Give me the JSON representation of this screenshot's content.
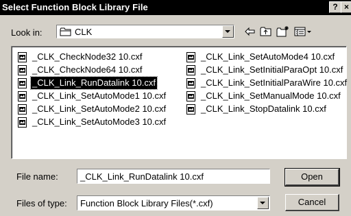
{
  "window": {
    "title": "Select Function Block Library File",
    "help_label": "?",
    "close_label": "×"
  },
  "lookin": {
    "label": "Look in:",
    "value": "CLK"
  },
  "files": [
    "_CLK_CheckNode32 10.cxf",
    "_CLK_CheckNode64 10.cxf",
    "_CLK_Link_RunDatalink 10.cxf",
    "_CLK_Link_SetAutoMode1 10.cxf",
    "_CLK_Link_SetAutoMode2 10.cxf",
    "_CLK_Link_SetAutoMode3 10.cxf",
    "_CLK_Link_SetAutoMode4 10.cxf",
    "_CLK_Link_SetInitialParaOpt 10.cxf",
    "_CLK_Link_SetInitialParaWire 10.cxf",
    "_CLK_Link_SetManualMode 10.cxf",
    "_CLK_Link_StopDatalink 10.cxf"
  ],
  "selected_file_index": 2,
  "filename": {
    "label": "File name:",
    "value": "_CLK_Link_RunDatalink 10.cxf"
  },
  "filetype": {
    "label": "Files of type:",
    "value": "Function Block Library Files(*.cxf)"
  },
  "buttons": {
    "open": "Open",
    "cancel": "Cancel"
  },
  "icons": {
    "folder": "folder-icon",
    "back": "back-arrow-icon",
    "up": "up-folder-icon",
    "new_folder": "new-folder-icon",
    "view_menu": "view-menu-icon",
    "file": "cxf-file-icon"
  }
}
